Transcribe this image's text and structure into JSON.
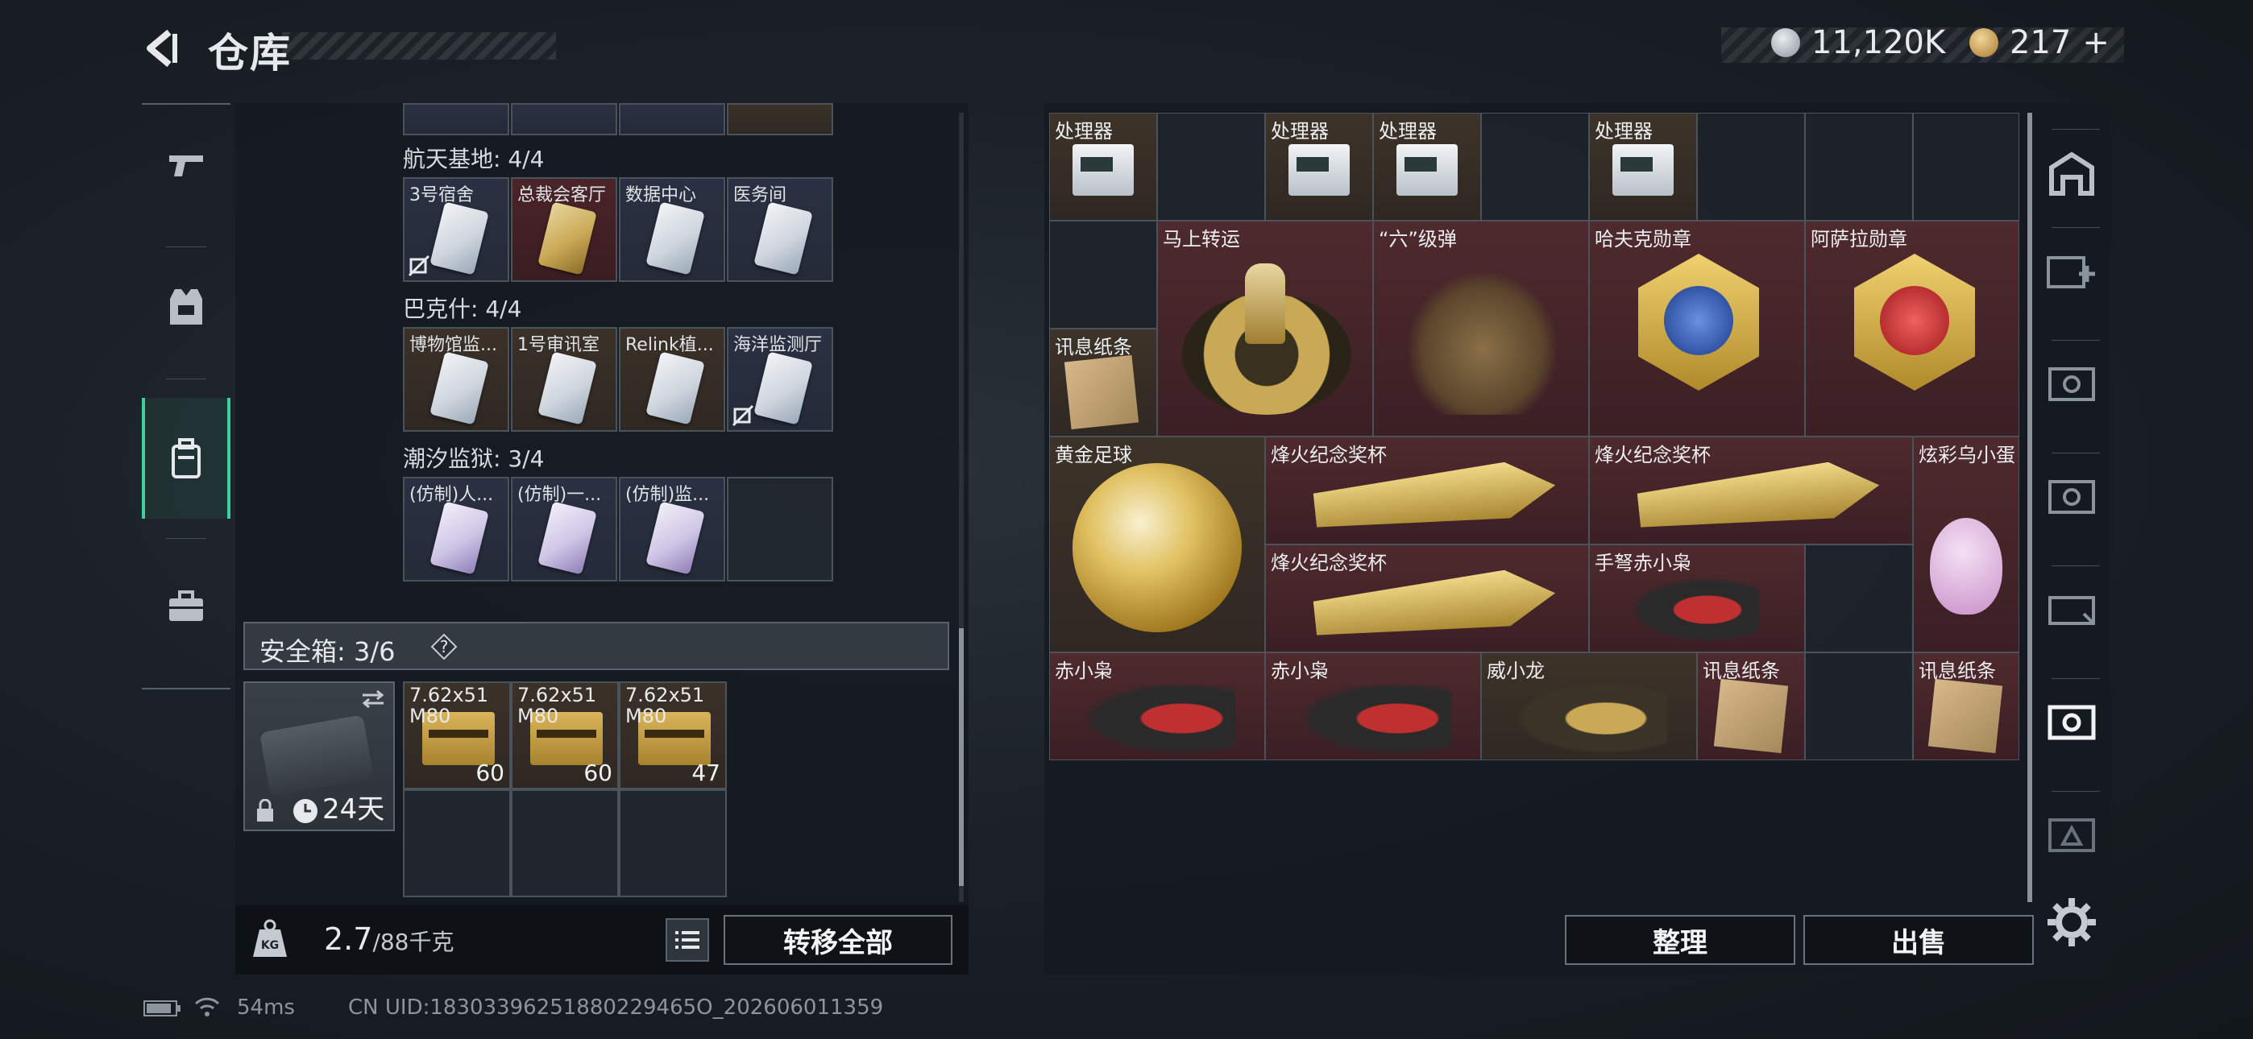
{
  "header": {
    "title": "仓库",
    "currency_1": "11,120K",
    "currency_2": "217",
    "currency_2_plus": "+"
  },
  "left": {
    "sections": [
      {
        "label": "航天基地: 4/4",
        "items": [
          "3号宿舍",
          "总裁会客厅",
          "数据中心",
          "医务间"
        ]
      },
      {
        "label": "巴克什: 4/4",
        "items": [
          "博物馆监...",
          "1号审讯室",
          "Relink植...",
          "海洋监测厅"
        ]
      },
      {
        "label": "潮汐监狱: 3/4",
        "items": [
          "(仿制)人...",
          "(仿制)一...",
          "(仿制)监...",
          ""
        ]
      }
    ],
    "safe_box": {
      "label": "安全箱: 3/6",
      "help": "?",
      "days": "24天"
    },
    "ammo": [
      {
        "name": "7.62x51 M80",
        "count": "60"
      },
      {
        "name": "7.62x51 M80",
        "count": "60"
      },
      {
        "name": "7.62x51 M80",
        "count": "47"
      }
    ],
    "weight_value": "2.7",
    "weight_total": "/88千克",
    "transfer_all": "转移全部"
  },
  "right": {
    "items": {
      "r0c0": "处理器",
      "r0c2": "处理器",
      "r0c3": "处理器",
      "r0c5": "处理器",
      "msg1": "讯息纸条",
      "mashang": "马上转运",
      "liu": "“六”级弹",
      "hafuke": "哈夫克勋章",
      "asala": "阿萨拉勋章",
      "ball": "黄金足球",
      "cup1": "烽火纪念奖杯",
      "cup2": "烽火纪念奖杯",
      "cup3": "烽火纪念奖杯",
      "xuancai": "炫彩乌小蛋",
      "shounu": "手弩赤小枭",
      "chi1": "赤小枭",
      "chi2": "赤小枭",
      "wei": "威小龙",
      "msg2": "讯息纸条",
      "msg3": "讯息纸条"
    },
    "sort": "整理",
    "sell": "出售"
  },
  "status": {
    "ping": "54ms",
    "uid": "CN UID:18303396251880229465O_202606011359"
  },
  "colors": {
    "accent": "#3fd0a0",
    "rare_red": "#4e2a2e",
    "gold": "#c9a955"
  },
  "icons": [
    "back-icon",
    "pistol-icon",
    "vest-icon",
    "backpack-icon",
    "briefcase-icon",
    "gear-icon",
    "lock-icon",
    "clock-icon",
    "swap-icon",
    "list-icon",
    "weight-icon"
  ]
}
